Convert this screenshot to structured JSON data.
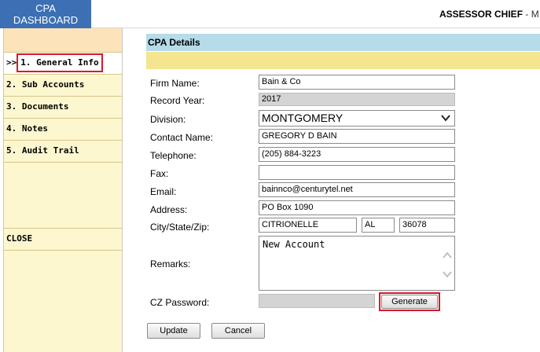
{
  "header": {
    "logo_line1": "CPA",
    "logo_line2": "DASHBOARD",
    "title": "ASSESSOR CHIEF",
    "title_suffix": " - M"
  },
  "sidebar": {
    "items": [
      {
        "label": "1. General Info",
        "prefix": ">>"
      },
      {
        "label": "2. Sub Accounts"
      },
      {
        "label": "3. Documents"
      },
      {
        "label": "4. Notes"
      },
      {
        "label": "5. Audit Trail"
      }
    ],
    "close_label": "CLOSE"
  },
  "section": {
    "title": "CPA Details"
  },
  "form": {
    "firm_name": {
      "label": "Firm Name:",
      "value": "Bain & Co"
    },
    "record_year": {
      "label": "Record Year:",
      "value": "2017"
    },
    "division": {
      "label": "Division:",
      "value": "MONTGOMERY"
    },
    "contact_name": {
      "label": "Contact Name:",
      "value": "GREGORY D BAIN"
    },
    "telephone": {
      "label": "Telephone:",
      "value": "(205) 884-3223"
    },
    "fax": {
      "label": "Fax:",
      "value": ""
    },
    "email": {
      "label": "Email:",
      "value": "bainnco@centurytel.net"
    },
    "address": {
      "label": "Address:",
      "value": "PO Box 1090"
    },
    "city_state_zip": {
      "label": "City/State/Zip:",
      "city": "CITRIONELLE",
      "state": "AL",
      "zip": "36078"
    },
    "remarks": {
      "label": "Remarks:",
      "value": "New Account"
    },
    "cz_password": {
      "label": "CZ Password:",
      "value": ""
    },
    "generate_label": "Generate"
  },
  "actions": {
    "update_label": "Update",
    "cancel_label": "Cancel"
  },
  "colors": {
    "highlight": "#d9182e",
    "logo_bg": "#3c6fb3",
    "section_title_bg": "#b6dbe9",
    "section_band_bg": "#f4e590",
    "sidebar_bg": "#fdf7cf"
  }
}
